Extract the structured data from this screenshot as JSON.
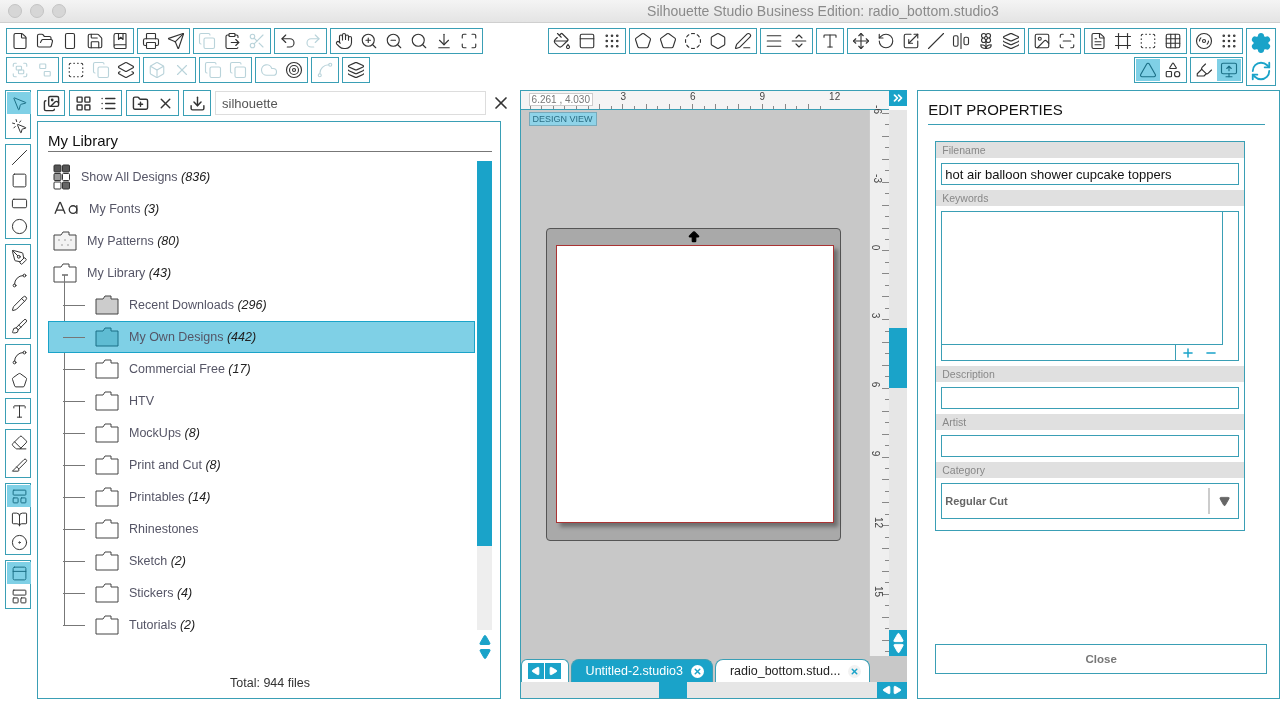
{
  "window": {
    "title": "Silhouette Studio Business Edition: radio_bottom.studio3"
  },
  "toolbar_row1": {
    "left": [
      [
        {
          "disabled": false
        },
        {
          "disabled": false
        },
        {
          "disabled": false
        },
        {
          "disabled": false
        },
        {
          "disabled": false
        }
      ],
      [
        {
          "disabled": false
        },
        {
          "disabled": false
        }
      ],
      [
        {
          "disabled": true
        },
        {
          "disabled": false
        },
        {
          "disabled": true
        }
      ],
      [
        {
          "disabled": false
        },
        {
          "disabled": true
        }
      ],
      [
        {
          "disabled": false
        },
        {
          "disabled": false
        },
        {
          "disabled": false
        },
        {
          "disabled": false
        },
        {
          "disabled": false
        },
        {
          "disabled": false
        }
      ]
    ],
    "right": [
      [
        {
          "disabled": false
        },
        {
          "disabled": false
        },
        {
          "disabled": false
        }
      ],
      [
        {
          "disabled": false
        },
        {
          "disabled": false
        },
        {
          "disabled": false
        },
        {
          "disabled": false
        },
        {
          "disabled": false
        }
      ],
      [
        {
          "disabled": false
        },
        {
          "disabled": false
        }
      ],
      [
        {
          "disabled": false
        }
      ],
      [
        {
          "disabled": false
        },
        {
          "disabled": false
        },
        {
          "disabled": false
        },
        {
          "disabled": false
        },
        {
          "disabled": false
        },
        {
          "disabled": false
        },
        {
          "disabled": false
        }
      ],
      [
        {
          "disabled": false
        },
        {
          "disabled": false
        }
      ],
      [
        {
          "disabled": false
        },
        {
          "disabled": false
        },
        {
          "disabled": false
        },
        {
          "disabled": false
        }
      ],
      [
        {
          "disabled": false
        },
        {
          "disabled": false
        }
      ]
    ]
  },
  "toolbar_row2": {
    "left": [
      [
        {
          "disabled": true
        },
        {
          "disabled": true
        }
      ],
      [
        {
          "disabled": false
        },
        {
          "disabled": true
        },
        {
          "disabled": false
        }
      ],
      [
        {
          "disabled": true
        },
        {
          "disabled": true
        }
      ],
      [
        {
          "disabled": true
        },
        {
          "disabled": true
        }
      ],
      [
        {
          "disabled": true
        },
        {
          "disabled": false
        }
      ],
      [
        {
          "disabled": true
        }
      ],
      [
        {
          "disabled": false
        }
      ]
    ],
    "right": [
      [
        {
          "selected": true
        },
        {
          "selected": false
        }
      ],
      [
        {
          "selected": false
        },
        {
          "selected": true
        }
      ]
    ]
  },
  "tools": [
    [
      {
        "selected": true
      },
      {
        "selected": false
      }
    ],
    [
      {
        "selected": false
      },
      {
        "selected": false
      },
      {
        "selected": false
      },
      {
        "selected": false
      }
    ],
    [
      {
        "selected": false
      },
      {
        "selected": false
      },
      {
        "selected": false
      },
      {
        "selected": false
      }
    ],
    [
      {
        "selected": false
      },
      {
        "selected": false
      }
    ],
    [
      {
        "selected": false
      }
    ],
    [
      {
        "selected": false
      },
      {
        "selected": false
      }
    ],
    [
      {
        "selected": true
      },
      {
        "selected": false
      },
      {
        "selected": false
      }
    ],
    [
      {
        "selected": true
      },
      {
        "selected": false
      }
    ]
  ],
  "library": {
    "search": {
      "value": "silhouette"
    },
    "title": "My Library",
    "items": [
      {
        "kind": "all",
        "label": "Show All Designs *(836)*",
        "selected": false
      },
      {
        "kind": "fonts",
        "label": "My Fonts *(3)*",
        "selected": false
      },
      {
        "kind": "patterns",
        "label": "My Patterns *(80)*",
        "selected": false
      },
      {
        "kind": "library",
        "label": "My Library *(43)*",
        "selected": false,
        "expanded": true,
        "children": [
          {
            "kind": "downloads",
            "label": "Recent Downloads *(296)*",
            "selected": false
          },
          {
            "kind": "folder",
            "label": "My Own Designs *(442)*",
            "selected": true
          },
          {
            "kind": "folder",
            "label": "Commercial Free *(17)*",
            "selected": false
          },
          {
            "kind": "folder",
            "label": "HTV",
            "selected": false
          },
          {
            "kind": "folder",
            "label": "MockUps *(8)*",
            "selected": false
          },
          {
            "kind": "folder",
            "label": "Print and Cut *(8)*",
            "selected": false
          },
          {
            "kind": "folder",
            "label": "Printables *(14)*",
            "selected": false
          },
          {
            "kind": "folder",
            "label": "Rhinestones",
            "selected": false
          },
          {
            "kind": "folder",
            "label": "Sketch *(2)*",
            "selected": false
          },
          {
            "kind": "folder",
            "label": "Stickers *(4)*",
            "selected": false
          },
          {
            "kind": "folder",
            "label": "Tutorials *(2)*",
            "selected": false
          }
        ]
      }
    ],
    "total": "Total: 944 files"
  },
  "canvas": {
    "coordinates": "6.261 , 4.030",
    "h_ruler": [
      "3",
      "6",
      "9",
      "12"
    ],
    "v_ruler": [
      "-6",
      "-3",
      "0",
      "3",
      "6",
      "9",
      "12",
      "15"
    ],
    "view_label": "DESIGN VIEW",
    "tabs": [
      {
        "label": "Untitled-2.studio3",
        "selected": true
      },
      {
        "label": "radio_bottom.stud...",
        "selected": false
      }
    ]
  },
  "properties": {
    "title": "EDIT PROPERTIES",
    "fields": [
      {
        "kind": "text",
        "label": "Filename",
        "value": "hot air balloon shower cupcake toppers"
      },
      {
        "kind": "list",
        "label": "Keywords"
      },
      {
        "kind": "text",
        "label": "Description"
      },
      {
        "kind": "text",
        "label": "Artist"
      },
      {
        "kind": "select",
        "label": "Category",
        "value": "Regular Cut"
      }
    ],
    "close_button": "Close"
  }
}
